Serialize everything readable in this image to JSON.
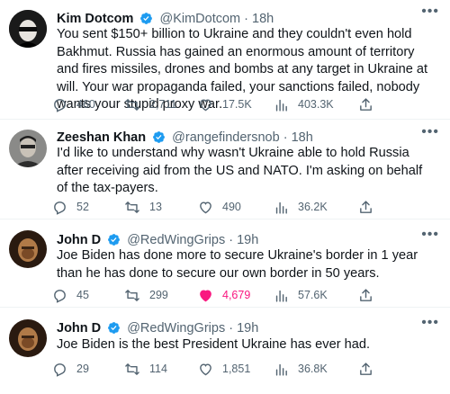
{
  "tweets": [
    {
      "name": "Kim Dotcom",
      "handle": "@KimDotcom",
      "dot": "·",
      "time": "18h",
      "text": "You sent $150+ billion to Ukraine and they couldn't even hold Bakhmut. Russia has gained an enormous amount of territory and fires missiles, drones and bombs at any target in Ukraine at will. Your war propaganda failed, your sanctions failed, nobody wants your stupid proxy war.",
      "replies": "460",
      "retweets": "2,711",
      "likes": "17.5K",
      "views": "403.3K",
      "liked": false
    },
    {
      "name": "Zeeshan Khan",
      "handle": "@rangefindersnob",
      "dot": "·",
      "time": "18h",
      "text": "I'd like to understand why wasn't Ukraine able to hold Russia after receiving aid from the US and NATO. I'm asking on behalf of the tax-payers.",
      "replies": "52",
      "retweets": "13",
      "likes": "490",
      "views": "36.2K",
      "liked": false
    },
    {
      "name": "John D",
      "handle": "@RedWingGrips",
      "dot": "·",
      "time": "19h",
      "text": "Joe Biden has done more to secure Ukraine's border in 1 year than he has done to secure our own border in 50 years.",
      "replies": "45",
      "retweets": "299",
      "likes": "4,679",
      "views": "57.6K",
      "liked": true
    },
    {
      "name": "John D",
      "handle": "@RedWingGrips",
      "dot": "·",
      "time": "19h",
      "text": "Joe Biden is the best President Ukraine has ever had.",
      "replies": "29",
      "retweets": "114",
      "likes": "1,851",
      "views": "36.8K",
      "liked": false
    }
  ],
  "colors": {
    "verified": "#1d9bf0",
    "like_active": "#f91880",
    "secondary_text": "#536471"
  },
  "icons": [
    "verified-badge-icon",
    "more-icon",
    "reply-icon",
    "retweet-icon",
    "like-icon",
    "views-icon",
    "share-icon"
  ]
}
